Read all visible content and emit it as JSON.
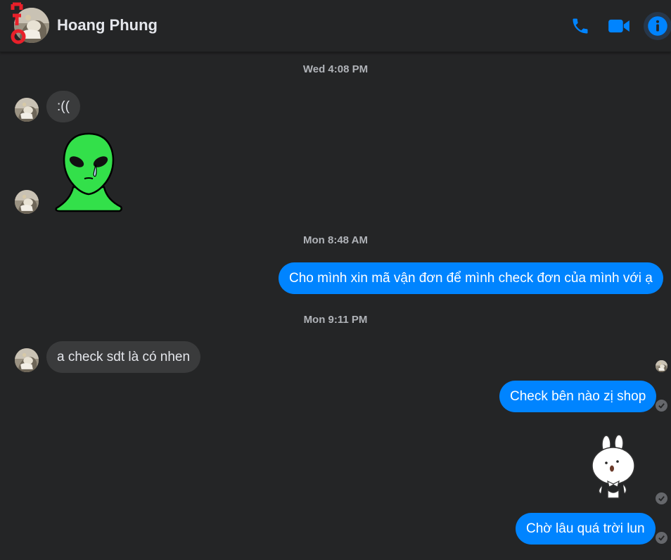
{
  "header": {
    "contact_name": "Hoang Phung",
    "overlay_logo_text": "OTO",
    "accent_color": "#0084ff"
  },
  "icons": {
    "phone": "phone-icon",
    "video": "video-camera-icon",
    "info": "info-icon",
    "delivered": "check-circle-icon"
  },
  "timestamps": {
    "t1": "Wed 4:08 PM",
    "t2": "Mon 8:48 AM",
    "t3": "Mon 9:11 PM"
  },
  "messages": {
    "m1": ":((",
    "m2": "Cho mình xin mã vận đơn để mình check đơn của mình với ạ",
    "m3": "a check sdt là có nhen",
    "m4": "Check bên nào zị shop",
    "m5": "Chờ lâu quá trời lun"
  },
  "stickers": {
    "s1": "green-alien-crying-sticker",
    "s2": "white-bunny-sticker"
  },
  "colors": {
    "background": "#242526",
    "incoming_bubble": "#3a3b3c",
    "outgoing_bubble": "#0084ff",
    "text": "#e4e6eb",
    "muted": "#b0b3b8"
  }
}
